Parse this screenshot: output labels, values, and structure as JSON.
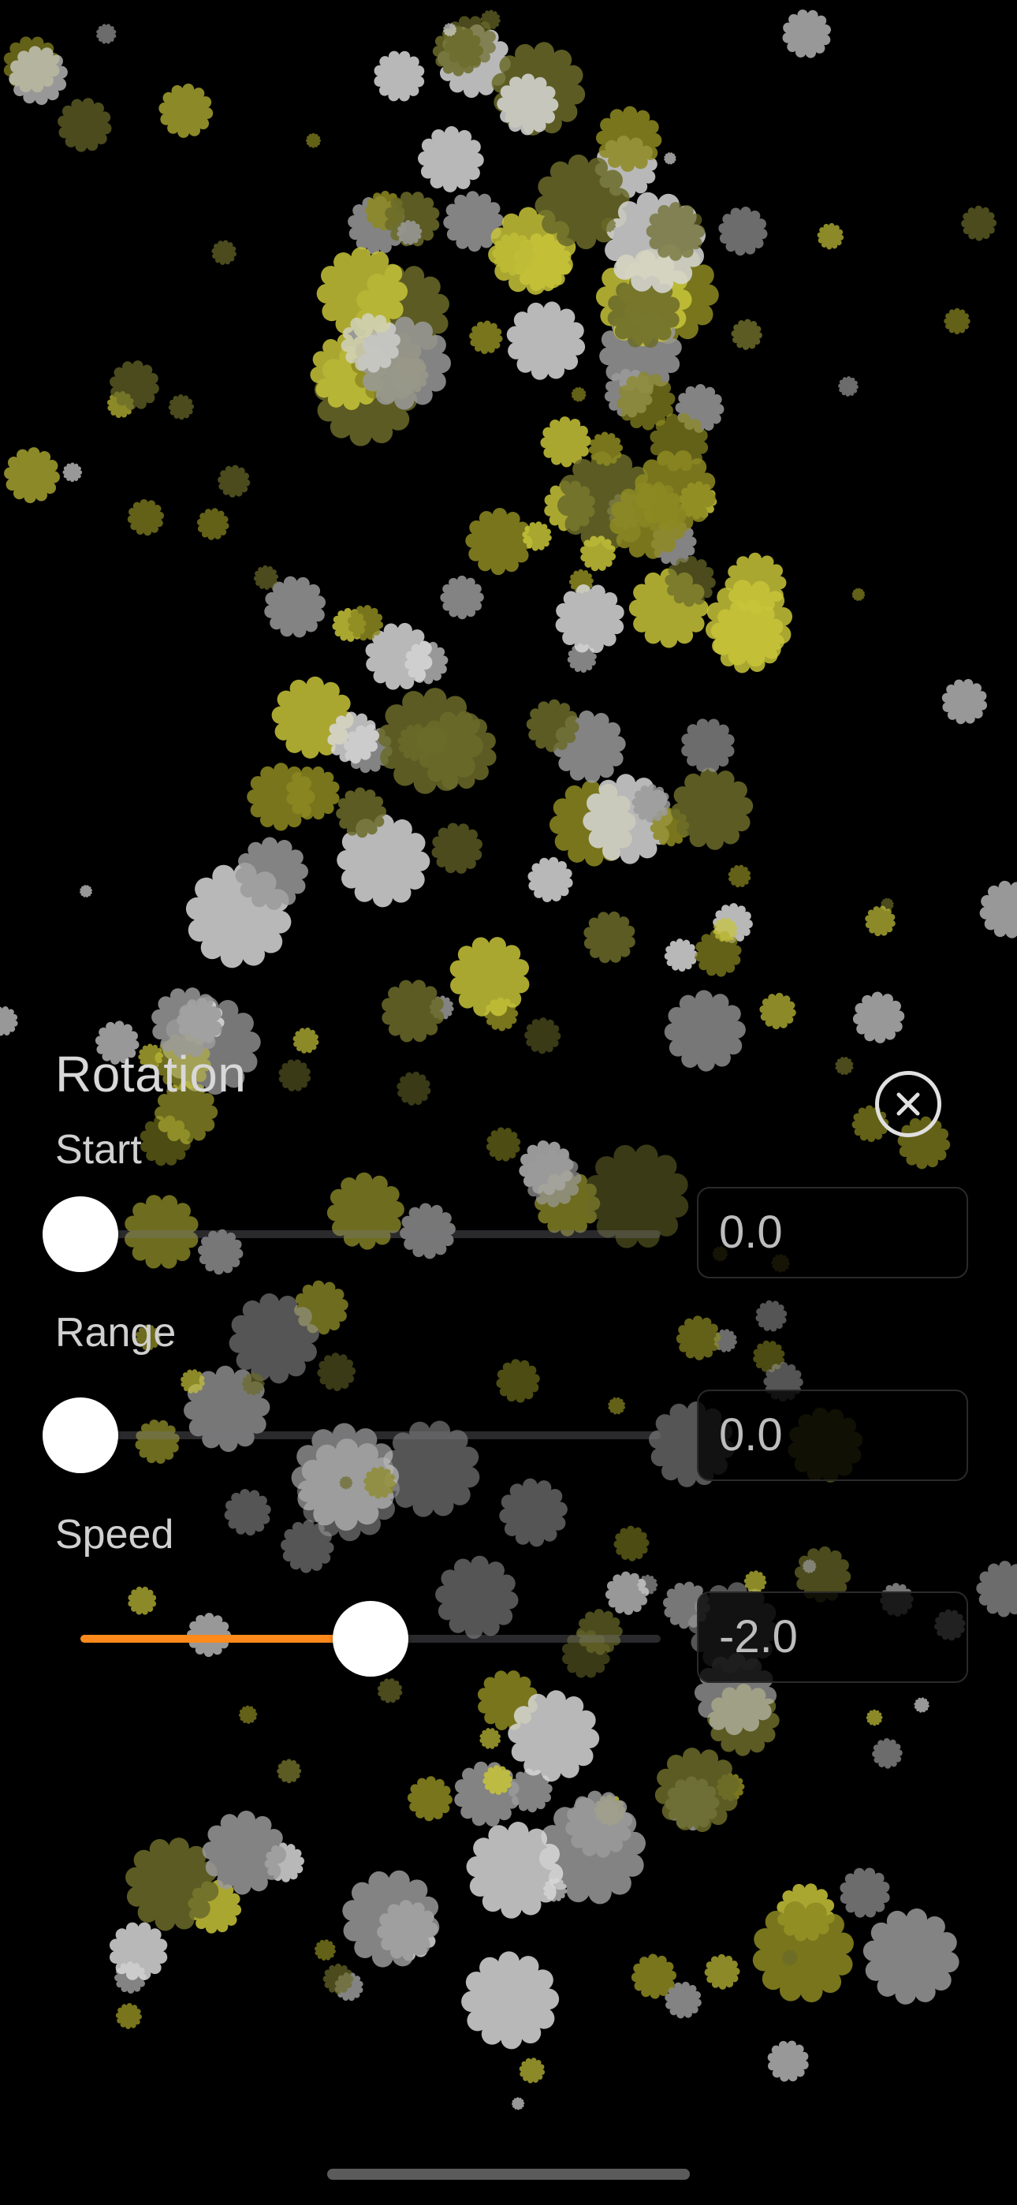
{
  "panel": {
    "title": "Rotation",
    "close_icon": "close-circle-icon",
    "accent_color": "#ff8a1c",
    "sliders": [
      {
        "label": "Start",
        "value_text": "0.0",
        "fraction": 0.0
      },
      {
        "label": "Range",
        "value_text": "0.0",
        "fraction": 0.0
      },
      {
        "label": "Speed",
        "value_text": "-2.0",
        "fraction": 0.5
      }
    ]
  },
  "particles": {
    "shape": "asterisk-flake-icon",
    "colors": [
      "#c8c53a",
      "#8d8a22",
      "#d9d9d9",
      "#9b9b9b",
      "#6b6b2a"
    ]
  }
}
